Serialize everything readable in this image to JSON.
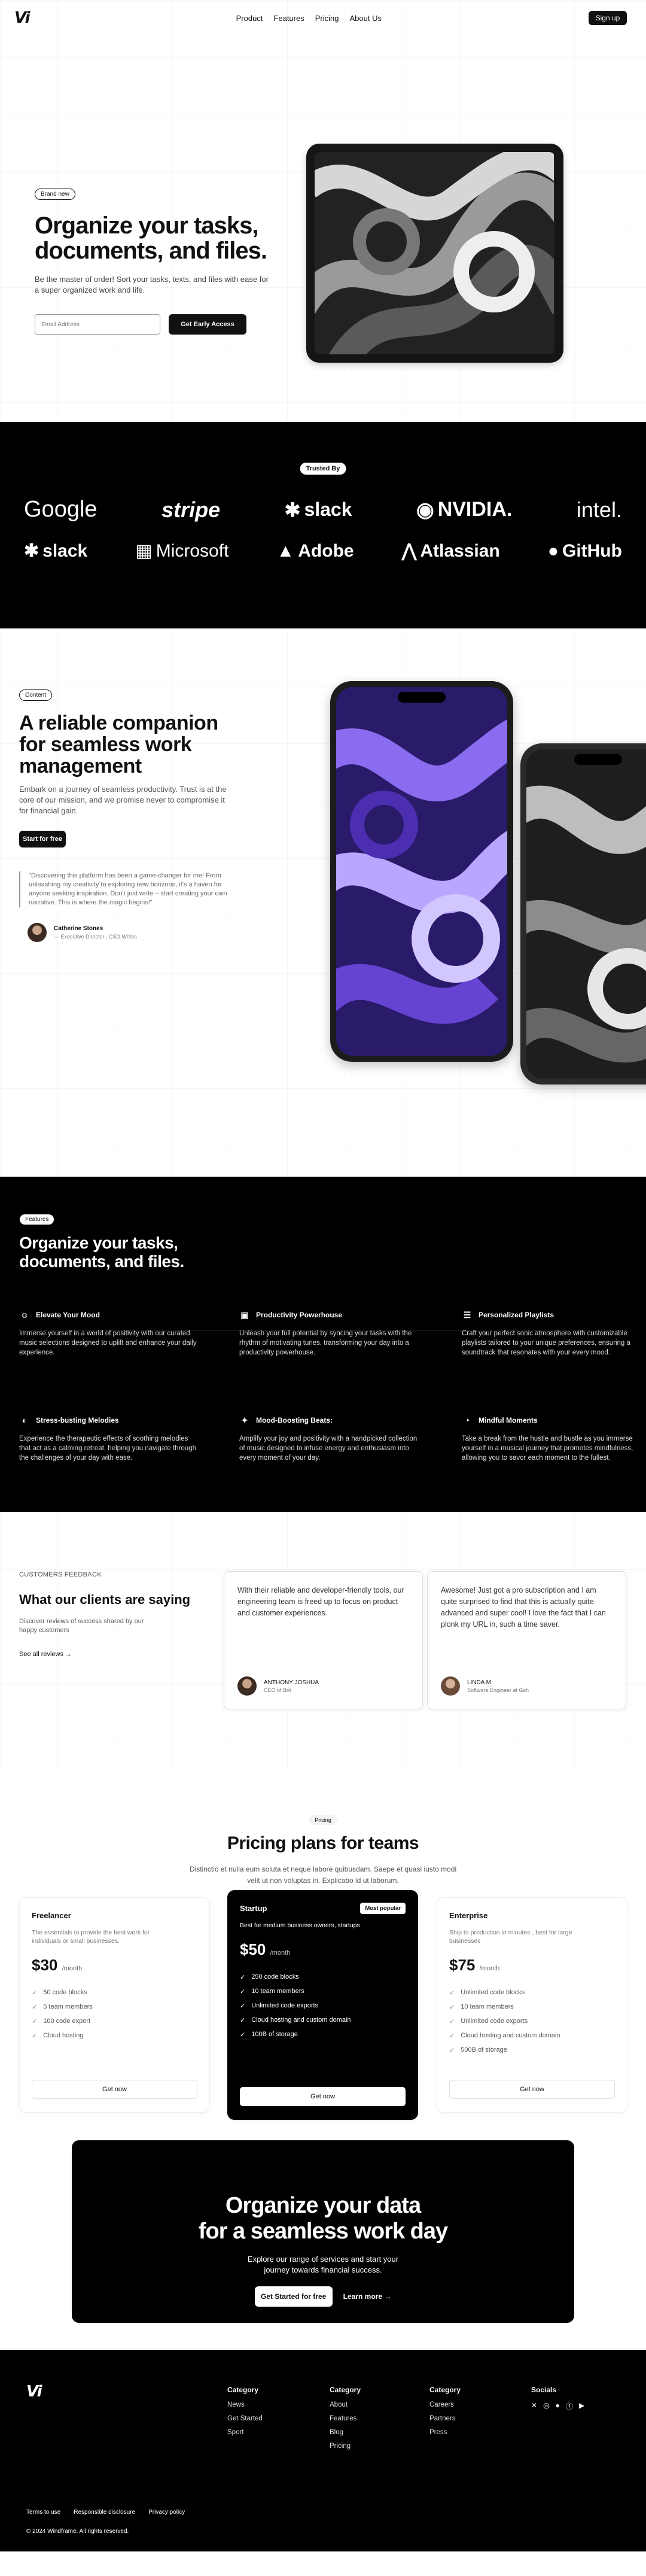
{
  "nav": {
    "logo": "Vi",
    "links": [
      "Product",
      "Features",
      "Pricing",
      "About Us"
    ],
    "signup": "Sign up"
  },
  "hero": {
    "badge": "Brand new",
    "title": "Organize your tasks, documents, and files.",
    "subtitle": "Be the master of order! Sort your tasks, texts, and files with ease for a super organized work and life.",
    "email_placeholder": "Email Address",
    "cta": "Get Early Access"
  },
  "trusted": {
    "badge": "Trusted By",
    "row1": [
      "Google",
      "stripe",
      "slack",
      "NVIDIA.",
      "intel."
    ],
    "row2": [
      "slack",
      "Microsoft",
      "Adobe",
      "Atlassian",
      "GitHub"
    ]
  },
  "companion": {
    "badge": "Content",
    "title": "A reliable companion for seamless work management",
    "description": "Embark on a journey of seamless productivity. Trust is at the core of our mission, and we promise never to compromise it for financial gain.",
    "cta": "Start for free",
    "quote": "\"Discovering this platform has been a game-changer for me! From unleashing my creativity to exploring new horizons, it's a haven for anyone seeking inspiration. Don't just write – start creating your own narrative. This is where the magic begins!\"",
    "author_name": "Catherine Stones",
    "author_role": "— Executive Director , CSD Writes"
  },
  "features": {
    "badge": "Features",
    "title": "Organize your tasks, documents, and files.",
    "items": [
      {
        "icon": "mood-icon",
        "title": "Elevate Your Mood",
        "text": "Immerse yourself in a world of positivity with our curated music selections designed to uplift and enhance your daily experience."
      },
      {
        "icon": "radio-icon",
        "title": "Productivity Powerhouse",
        "text": "Unleash your full potential by syncing your tasks with the rhythm of motivating tunes, transforming your day into a productivity powerhouse."
      },
      {
        "icon": "playlist-icon",
        "title": "Personalized Playlists",
        "text": "Craft your perfect sonic atmosphere with customizable playlists tailored to your unique preferences, ensuring a soundtrack that resonates with your every mood."
      },
      {
        "icon": "speaker-icon",
        "title": "Stress-busting Melodies",
        "text": "Experience the therapeutic effects of soothing melodies that act as a calming retreat, helping you navigate through the challenges of your day with ease."
      },
      {
        "icon": "sparkle-icon",
        "title": "Mood-Boosting Beats:",
        "text": "Amplify your joy and positivity with a handpicked collection of music designed to infuse energy and enthusiasm into every moment of your day."
      },
      {
        "icon": "timer-icon",
        "title": "Mindful Moments",
        "text": "Take a break from the hustle and bustle as you immerse yourself in a musical journey that promotes mindfulness, allowing you to savor each moment to the fullest."
      }
    ]
  },
  "testimonials": {
    "tag": "CUSTOMERS FEEDBACK",
    "title": "What our clients are saying",
    "description": "Discover reviews of success shared by our happy customers",
    "see_all": "See all reviews →",
    "cards": [
      {
        "text": "With their reliable and developer-friendly tools, our engineering team is freed up to focus on product and customer experiences.",
        "name": "ANTHONY JOSHUA",
        "role": "CEO of Brit"
      },
      {
        "text": "Awesome! Just got a pro subscription and I am quite surprised to find that this is actually quite advanced and super cool! I love the fact that I can plonk my URL in, such a time saver.",
        "name": "LINDA M.",
        "role": "Software Engineer at Gsh"
      }
    ]
  },
  "pricing": {
    "badge": "Pricing",
    "title": "Pricing plans for teams",
    "description": "Distinctio et nulla eum soluta et neque labore quibusdam. Saepe et quasi iusto modi velit ut non voluptas in. Explicabo id ut laborum.",
    "plans": [
      {
        "name": "Freelancer",
        "desc": "The essentials to provide the best work for individuals or small businesses.",
        "price": "$30",
        "per": "/month",
        "features": [
          "50 code blocks",
          "5 team members",
          "100 code export",
          "Cloud hosting"
        ],
        "cta": "Get now"
      },
      {
        "name": "Startup",
        "badge": "Most popular",
        "desc": "Best for medium business owners, startups",
        "price": "$50",
        "per": "/month",
        "features": [
          "250 code blocks",
          "10 team members",
          "Unlimited code exports",
          "Cloud hosting and custom domain",
          "100B of storage"
        ],
        "cta": "Get now"
      },
      {
        "name": "Enterprise",
        "desc": "Ship to production in minutes , best for large businesses",
        "price": "$75",
        "per": "/month",
        "features": [
          "Unlimited code blocks",
          "10 team members",
          "Unlimited code exports",
          "Cloud hosting and custom domain",
          "500B of storage"
        ],
        "cta": "Get now"
      }
    ]
  },
  "cta_block": {
    "title_line1": "Organize your data",
    "title_line2": "for a seamless work day",
    "text": "Explore our range of services and start your journey towards financial success.",
    "primary": "Get Started for free",
    "secondary": "Learn more →"
  },
  "footer": {
    "logo": "Vi",
    "columns": [
      {
        "title": "Category",
        "links": [
          "News",
          "Get Started",
          "Sport"
        ]
      },
      {
        "title": "Category",
        "links": [
          "About",
          "Features",
          "Blog",
          "Pricing"
        ]
      },
      {
        "title": "Category",
        "links": [
          "Careers",
          "Partners",
          "Press"
        ]
      }
    ],
    "social_title": "Socials",
    "social_icons": [
      "x-icon",
      "instagram-icon",
      "github-icon",
      "facebook-icon",
      "youtube-icon"
    ],
    "bottom_links": [
      "Terms to use",
      "Responsible disclosure",
      "Privacy policy"
    ],
    "copyright": "© 2024 Windframe. All rights reserved."
  }
}
